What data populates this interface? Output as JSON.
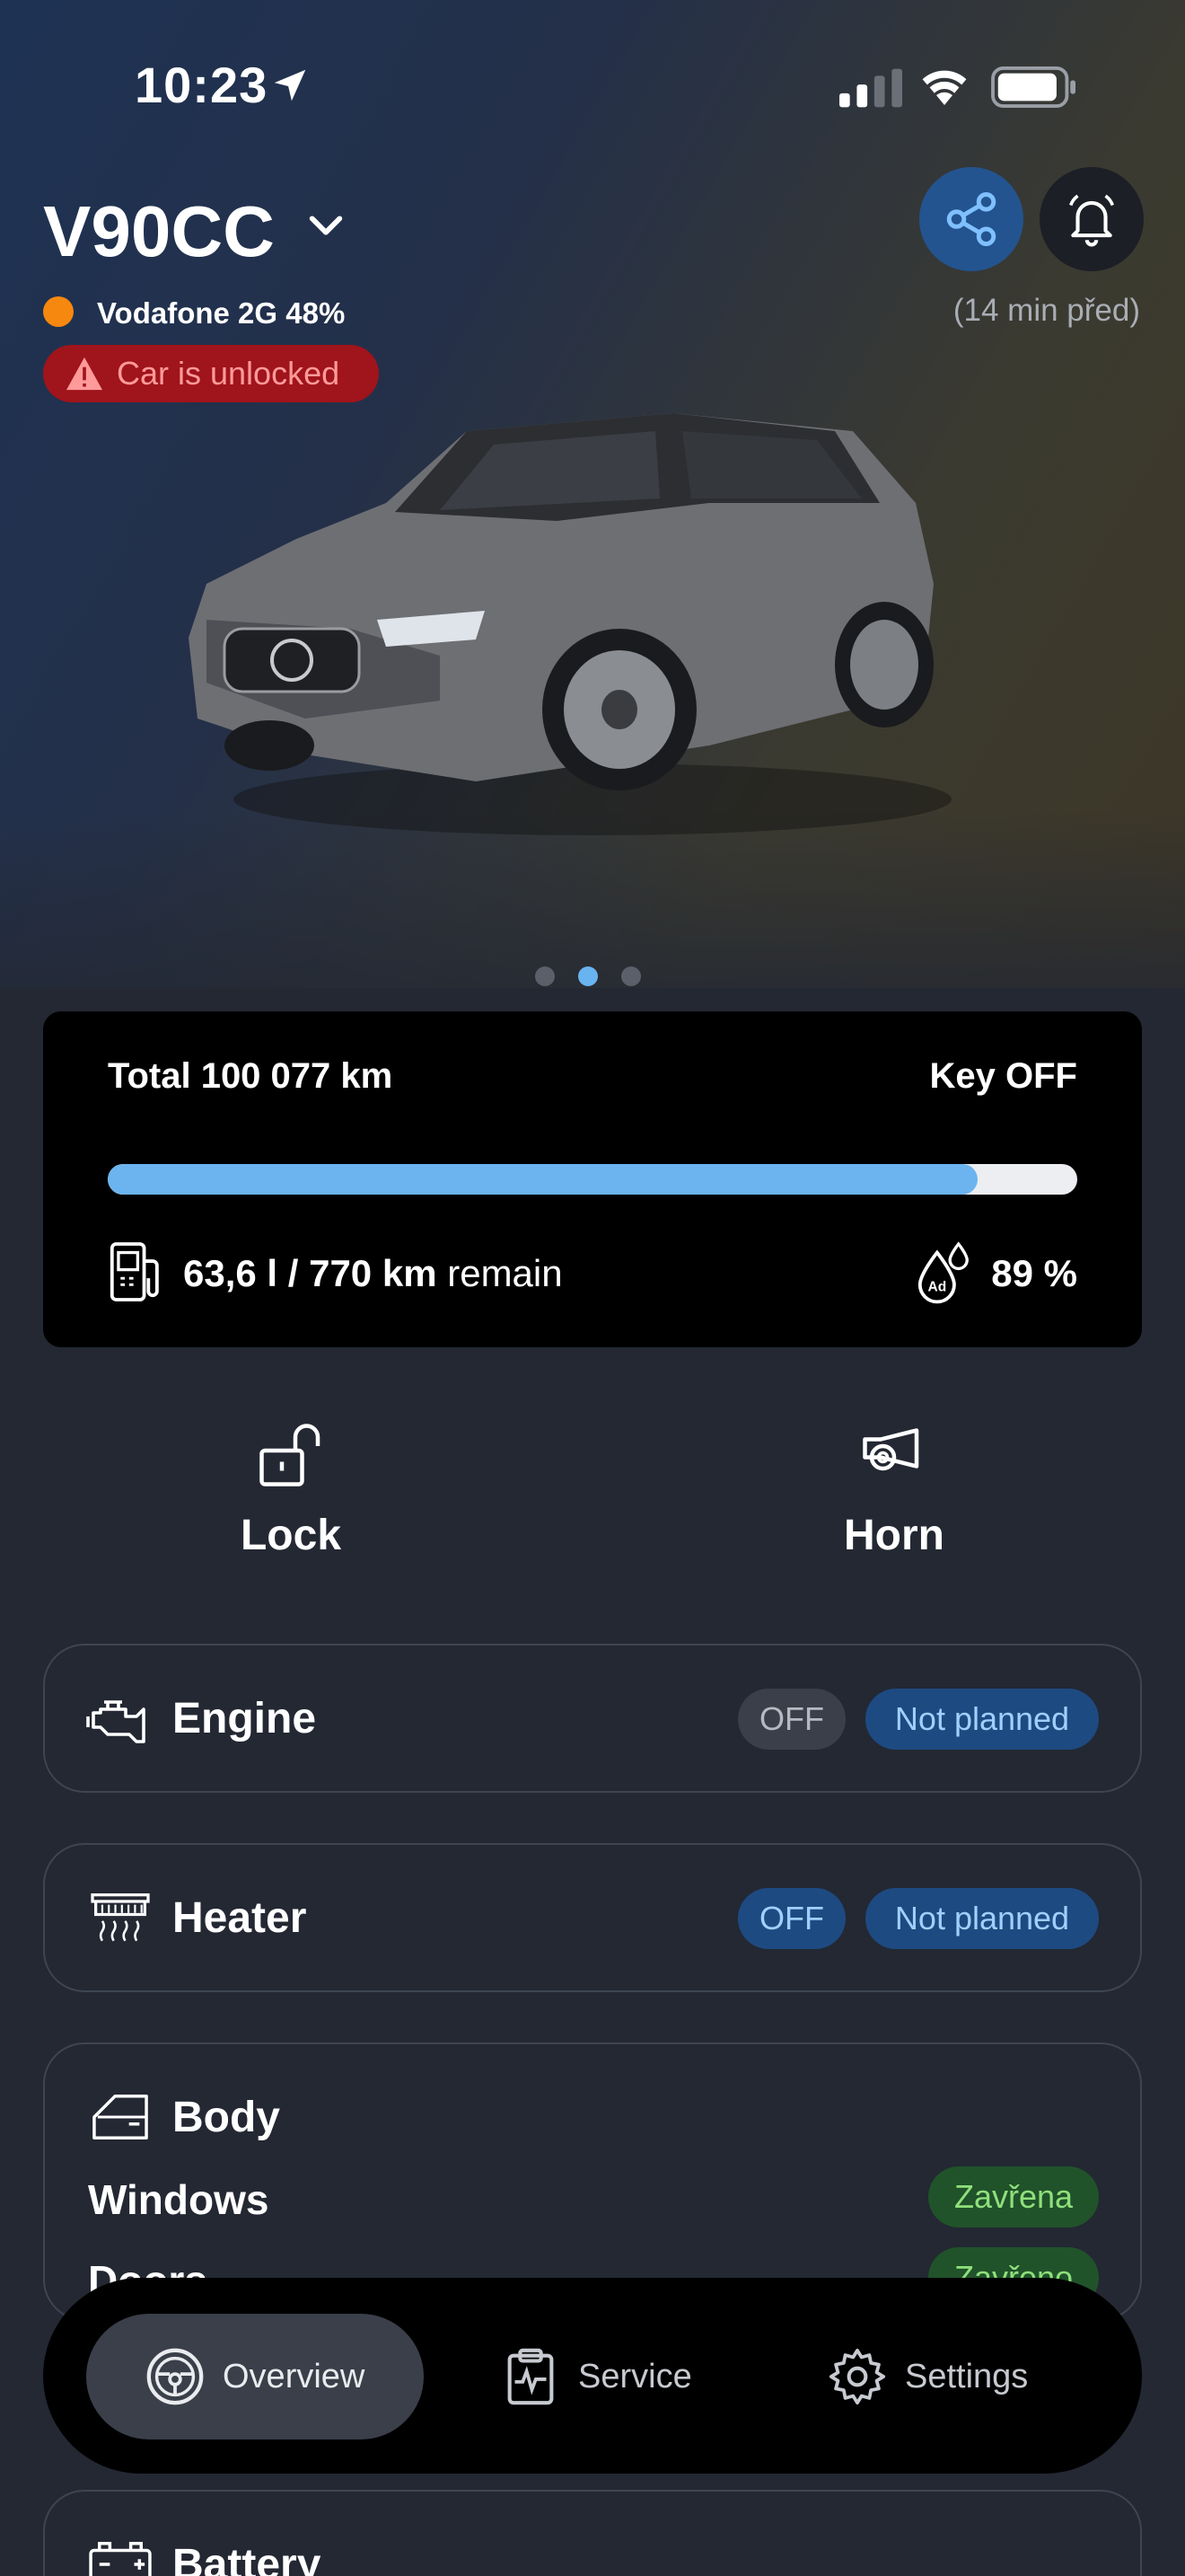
{
  "status_bar": {
    "time": "10:23"
  },
  "header": {
    "car_name": "V90CC",
    "network": "Vodafone 2G 48%",
    "alert": "Car is unlocked",
    "updated_ago": "(14 min před)"
  },
  "carousel": {
    "pages": 3,
    "active": 2
  },
  "info_card": {
    "total": "Total 100 077  km",
    "key": "Key OFF",
    "fuel_fraction": 0.897,
    "fuel_value": "63,6 l / 770 km",
    "fuel_suffix": "remain",
    "adblue": "89 %"
  },
  "actions": {
    "lock": "Lock",
    "horn": "Horn"
  },
  "engine": {
    "title": "Engine",
    "state": "OFF",
    "plan": "Not planned"
  },
  "heater": {
    "title": "Heater",
    "state": "OFF",
    "plan": "Not planned"
  },
  "body": {
    "title": "Body",
    "windows_label": "Windows",
    "windows_status": "Zavřena",
    "doors_label": "Doors",
    "doors_status": "Zavřeno"
  },
  "battery": {
    "title": "Battery"
  },
  "nav": {
    "overview": "Overview",
    "service": "Service",
    "settings": "Settings"
  },
  "colors": {
    "accent": "#6cb4ef",
    "alert_bg": "#a0141b",
    "network_dot": "#f6880f"
  }
}
